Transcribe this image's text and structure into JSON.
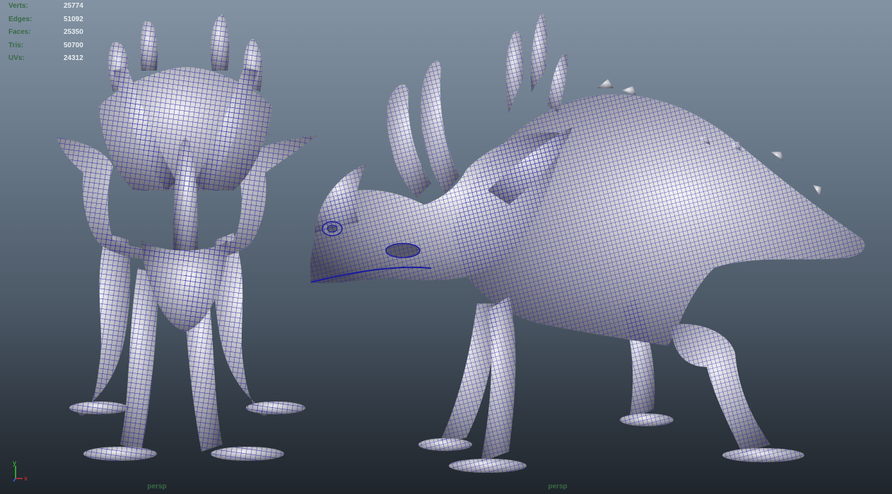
{
  "colors": {
    "stat_label": "#3a6a46",
    "stat_value": "#e8ecef",
    "wire": "#1a1aa0",
    "surface_light": "#e8e8ec",
    "surface_dark": "#5c5c66",
    "axis_x": "#c83232",
    "axis_y": "#3ac83a",
    "axis_z": "#3a64e6",
    "camera_label": "#3a6a46"
  },
  "stats": [
    {
      "label": "Verts:",
      "value": "25774"
    },
    {
      "label": "Edges:",
      "value": "51092"
    },
    {
      "label": "Faces:",
      "value": "25350"
    },
    {
      "label": "Tris:",
      "value": "50700"
    },
    {
      "label": "UVs:",
      "value": "24312"
    }
  ],
  "axis": {
    "x": "x",
    "y": "y"
  },
  "cameras": [
    "persp",
    "persp"
  ]
}
